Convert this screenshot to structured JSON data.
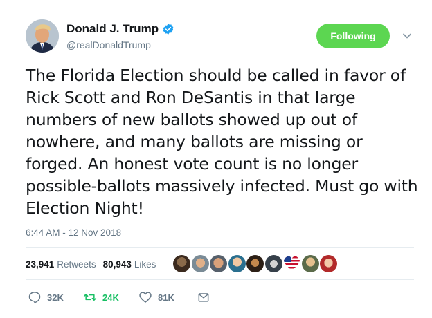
{
  "author": {
    "display_name": "Donald J. Trump",
    "handle": "@realDonaldTrump",
    "verified": true
  },
  "follow_button": {
    "label": "Following",
    "color": "#5cd651"
  },
  "tweet": {
    "text": "The Florida Election should be called in favor of Rick Scott and Ron DeSantis in that large numbers of new ballots showed up out of nowhere, and many ballots are missing or forged. An honest vote count is no longer possible-ballots massively infected. Must go with Election Night!",
    "timestamp": "6:44 AM - 12 Nov 2018"
  },
  "stats": {
    "retweets_count": "23,941",
    "retweets_label": "Retweets",
    "likes_count": "80,943",
    "likes_label": "Likes"
  },
  "actions": {
    "replies": "32K",
    "retweets": "24K",
    "likes": "81K"
  },
  "colors": {
    "text": "#14171a",
    "secondary": "#657786",
    "verified": "#1da1f2",
    "retweet": "#17bf63",
    "divider": "#e6ecf0"
  },
  "liker_avatars": [
    "avatar-1",
    "avatar-2",
    "avatar-3",
    "avatar-4",
    "avatar-5",
    "avatar-6",
    "avatar-7",
    "avatar-8",
    "avatar-9"
  ]
}
